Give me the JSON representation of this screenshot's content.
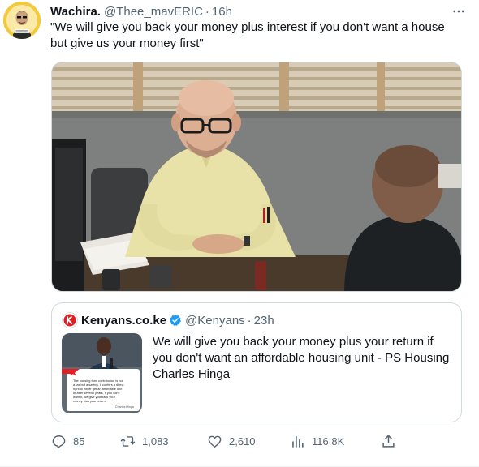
{
  "tweet": {
    "display_name": "Wachira.",
    "handle": "@Thee_mavERIC",
    "separator": "·",
    "time": "16h",
    "text": "\"We will give you back your money plus interest if you don't want a house but give us your money first\""
  },
  "quoted_tweet": {
    "display_name": "Kenyans.co.ke",
    "handle": "@Kenyans",
    "separator": "·",
    "time": "23h",
    "text": "We will give you back your money plus your return if you don't want an affordable housing unit - PS Housing Charles Hinga",
    "thumbnail_lines": [
      "The housing fund contribution is not",
      "a tax but a saving. It confers a direct",
      "right to either get an affordable unit",
      "or after several years, if you don't",
      "want it, we give you back your",
      "money plus your return.",
      "Charles Hinga"
    ]
  },
  "actions": {
    "reply_count": "85",
    "retweet_count": "1,083",
    "like_count": "2,610",
    "view_count": "116.8K"
  },
  "icons": {
    "more": "more-horizontal-icon",
    "reply": "reply-icon",
    "retweet": "retweet-icon",
    "like": "heart-icon",
    "views": "views-icon",
    "share": "share-icon",
    "verified": "verified-badge-icon"
  },
  "colors": {
    "text_primary": "#0f1419",
    "text_secondary": "#536471",
    "border": "#cfd9de",
    "verified_blue": "#1d9bf0",
    "kenyans_red": "#e31e24"
  }
}
